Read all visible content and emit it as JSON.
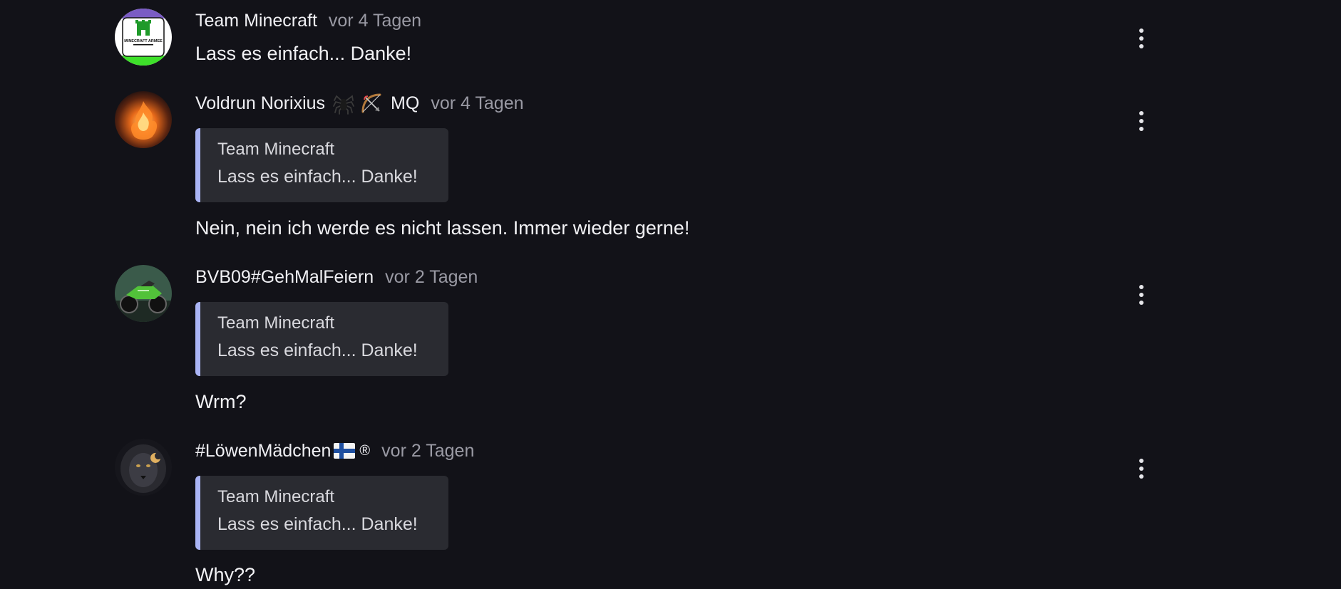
{
  "comments": [
    {
      "author": "Team Minecraft",
      "time": "vor 4 Tagen",
      "text": "Lass es einfach... Danke!",
      "avatar_icon": "castle-logo-icon",
      "avatar_logo_text": "MINECRAFT ARMEE"
    },
    {
      "author": "Voldrun Norixius",
      "badge_icons": [
        "spider-emoji-icon",
        "bow-and-arrow-emoji-icon"
      ],
      "badge_text": "MQ",
      "time": "vor 4 Tagen",
      "quote": {
        "author": "Team Minecraft",
        "text": "Lass es einfach... Danke!"
      },
      "text": "Nein, nein ich werde es nicht lassen. Immer wieder gerne!",
      "avatar_icon": "fire-figure-icon"
    },
    {
      "author": "BVB09#GehMalFeiern",
      "time": "vor 2 Tagen",
      "quote": {
        "author": "Team Minecraft",
        "text": "Lass es einfach... Danke!"
      },
      "text": "Wrm?",
      "avatar_icon": "motorcycle-icon"
    },
    {
      "author": "#LöwenMädchen",
      "badge_icons": [
        "finland-flag-icon",
        "registered-sign-icon"
      ],
      "badge_registered": "®",
      "time": "vor 2 Tagen",
      "quote": {
        "author": "Team Minecraft",
        "text": "Lass es einfach... Danke!"
      },
      "text": "Why??",
      "avatar_icon": "lion-icon"
    }
  ],
  "colors": {
    "background": "#121218",
    "quote_background": "#2a2b31",
    "quote_accent": "#aab4f5",
    "timestamp": "#9a9aa4"
  }
}
